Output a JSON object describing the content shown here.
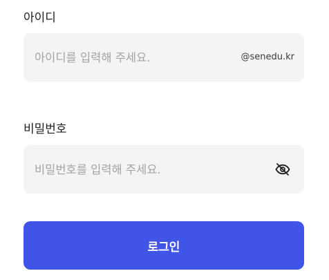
{
  "login_form": {
    "id_field": {
      "label": "아이디",
      "placeholder": "아이디를 입력해 주세요.",
      "value": "",
      "domain_suffix": "@senedu.kr"
    },
    "password_field": {
      "label": "비밀번호",
      "placeholder": "비밀번호를 입력해 주세요.",
      "value": "",
      "toggle_icon": "eye-off-icon"
    },
    "submit_label": "로그인"
  },
  "colors": {
    "input_background": "#f4f4f5",
    "placeholder": "#a3a3a8",
    "button_background": "#4154e8",
    "button_text": "#ffffff",
    "label_text": "#1f1f1f"
  }
}
